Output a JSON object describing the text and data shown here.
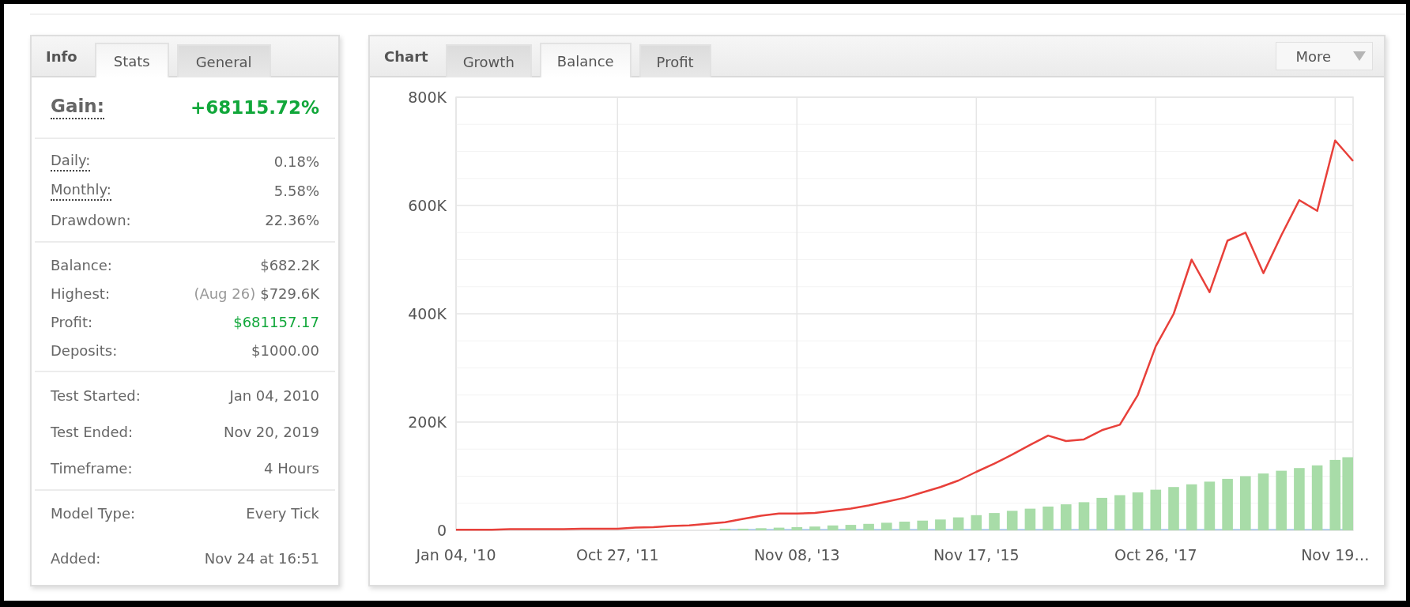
{
  "info_panel": {
    "title": "Info",
    "tabs": [
      {
        "label": "Stats",
        "selected": true
      },
      {
        "label": "General",
        "selected": false
      }
    ],
    "gain": {
      "label": "Gain:",
      "value": "+68115.72%"
    },
    "groups": [
      [
        {
          "label": "Daily:",
          "value": "0.18%",
          "underlined": true,
          "positive": false
        },
        {
          "label": "Monthly:",
          "value": "5.58%",
          "underlined": true,
          "positive": false
        },
        {
          "label": "Drawdown:",
          "value": "22.36%",
          "underlined": false,
          "positive": false
        }
      ],
      [
        {
          "label": "Balance:",
          "value": "$682.2K",
          "underlined": false,
          "positive": false
        },
        {
          "label": "Highest:",
          "note": "(Aug 26)",
          "value": "$729.6K",
          "underlined": false,
          "positive": false
        },
        {
          "label": "Profit:",
          "value": "$681157.17",
          "underlined": false,
          "positive": true
        },
        {
          "label": "Deposits:",
          "value": "$1000.00",
          "underlined": false,
          "positive": false
        }
      ],
      [
        {
          "label": "Test Started:",
          "value": "Jan 04, 2010",
          "underlined": false,
          "positive": false
        },
        {
          "label": "Test Ended:",
          "value": "Nov 20, 2019",
          "underlined": false,
          "positive": false
        },
        {
          "label": "Timeframe:",
          "value": "4 Hours",
          "underlined": false,
          "positive": false
        }
      ],
      [
        {
          "label": "Model Type:",
          "value": "Every Tick",
          "underlined": false,
          "positive": false
        },
        {
          "label": "Added:",
          "value": "Nov 24 at 16:51",
          "underlined": false,
          "positive": false
        }
      ]
    ]
  },
  "chart_panel": {
    "title": "Chart",
    "tabs": [
      {
        "label": "Growth",
        "selected": false
      },
      {
        "label": "Balance",
        "selected": true
      },
      {
        "label": "Profit",
        "selected": false
      }
    ],
    "more_button": "More",
    "chart_data": {
      "type": "line",
      "grid": true,
      "ylim": [
        0,
        800000
      ],
      "yticks": [
        {
          "value": 0,
          "label": "0"
        },
        {
          "value": 200000,
          "label": "200K"
        },
        {
          "value": 400000,
          "label": "400K"
        },
        {
          "value": 600000,
          "label": "600K"
        },
        {
          "value": 800000,
          "label": "800K"
        }
      ],
      "categories": [
        "Jan 04, '10",
        null,
        null,
        null,
        null,
        null,
        null,
        null,
        null,
        "Oct 27, '11",
        null,
        null,
        null,
        null,
        null,
        null,
        null,
        null,
        null,
        "Nov 08, '13",
        null,
        null,
        null,
        null,
        null,
        null,
        null,
        null,
        null,
        "Nov 17, '15",
        null,
        null,
        null,
        null,
        null,
        null,
        null,
        null,
        null,
        "Oct 26, '17",
        null,
        null,
        null,
        null,
        null,
        null,
        null,
        null,
        null,
        "Nov 19…",
        null
      ],
      "series": [
        {
          "color": "#e8403a",
          "values": [
            1000,
            1000,
            1000,
            2000,
            2000,
            2000,
            2000,
            3000,
            3000,
            3000,
            5000,
            6000,
            8000,
            9000,
            12000,
            15000,
            21000,
            27000,
            31000,
            31000,
            32000,
            36000,
            40000,
            46000,
            53000,
            60000,
            70000,
            80000,
            92000,
            108000,
            123000,
            140000,
            158000,
            175000,
            165000,
            168000,
            185000,
            195000,
            250000,
            340000,
            400000,
            500000,
            440000,
            535000,
            550000,
            475000,
            545000,
            610000,
            590000,
            720000,
            682000
          ]
        },
        {
          "type": "bar",
          "color": "#a8dca8",
          "values": [
            0,
            0,
            0,
            0,
            0,
            0,
            0,
            0,
            0,
            0,
            0,
            0,
            0,
            0,
            0,
            3000,
            3000,
            4000,
            5000,
            6000,
            7000,
            9000,
            10000,
            12000,
            14000,
            16000,
            18000,
            20000,
            24000,
            28000,
            32000,
            36000,
            40000,
            44000,
            48000,
            52000,
            60000,
            65000,
            70000,
            75000,
            80000,
            85000,
            90000,
            95000,
            100000,
            105000,
            110000,
            115000,
            120000,
            130000,
            135000
          ]
        }
      ]
    }
  }
}
